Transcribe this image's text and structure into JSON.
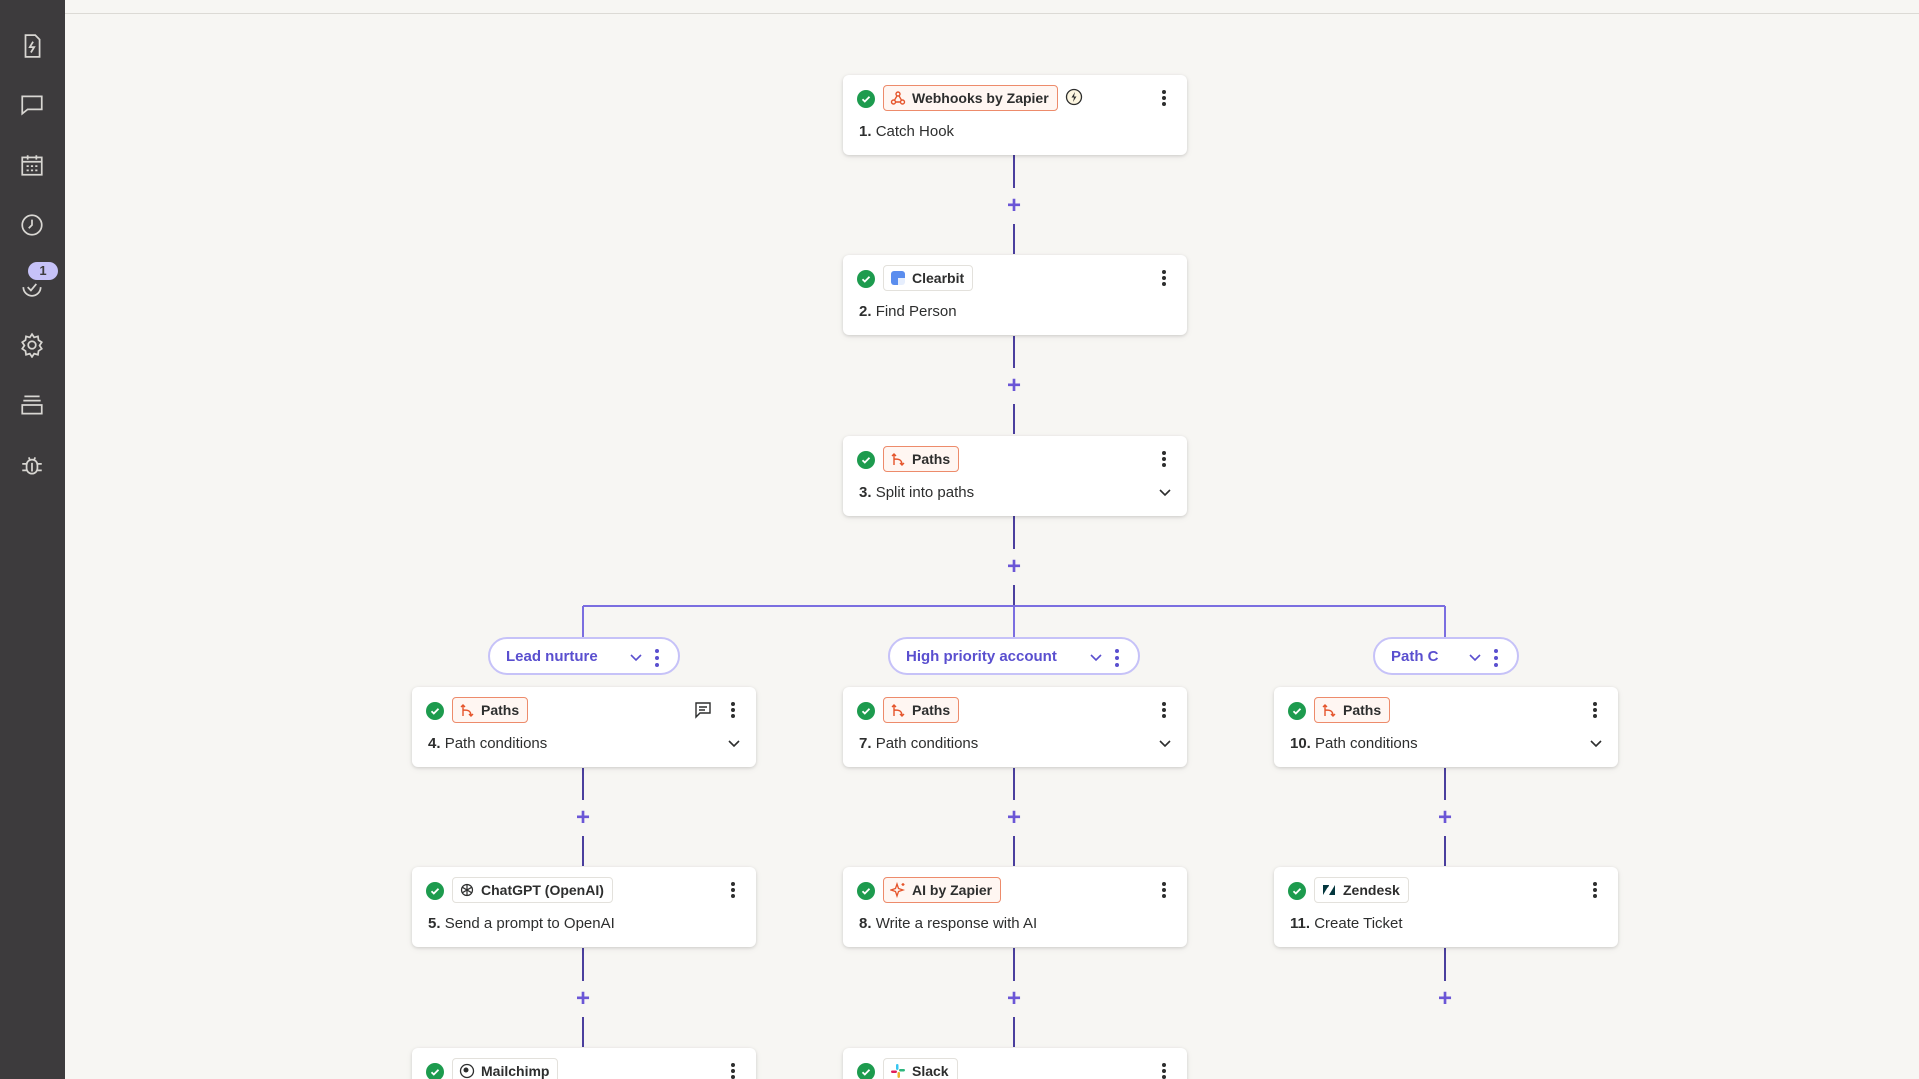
{
  "sidebar": {
    "icons": [
      "zap-file-icon",
      "chat-icon",
      "calendar-icon",
      "history-icon",
      "cloud-sync-icon",
      "settings-icon",
      "layers-icon",
      "bug-icon"
    ],
    "badge": "1"
  },
  "colors": {
    "accent": "#6b56d6",
    "success": "#1d9b4e",
    "orange": "#ed8b6b",
    "sidebar": "#3d3b3d",
    "canvas": "#f7f6f3"
  },
  "nodes": [
    {
      "app": "Webhooks by Zapier",
      "num": "1.",
      "title": "Catch Hook"
    },
    {
      "app": "Clearbit",
      "num": "2.",
      "title": "Find Person"
    },
    {
      "app": "Paths",
      "num": "3.",
      "title": "Split into paths"
    },
    {
      "app": "Paths",
      "num": "4.",
      "title": "Path conditions"
    },
    {
      "app": "ChatGPT (OpenAI)",
      "num": "5.",
      "title": "Send a prompt to OpenAI"
    },
    {
      "app": "Mailchimp",
      "num": "",
      "title": ""
    },
    {
      "app": "Paths",
      "num": "7.",
      "title": "Path conditions"
    },
    {
      "app": "AI by Zapier",
      "num": "8.",
      "title": "Write a response with AI"
    },
    {
      "app": "Slack",
      "num": "",
      "title": ""
    },
    {
      "app": "Paths",
      "num": "10.",
      "title": "Path conditions"
    },
    {
      "app": "Zendesk",
      "num": "11.",
      "title": "Create Ticket"
    }
  ],
  "paths": [
    {
      "label": "Lead nurture"
    },
    {
      "label": "High priority account"
    },
    {
      "label": "Path C"
    }
  ]
}
